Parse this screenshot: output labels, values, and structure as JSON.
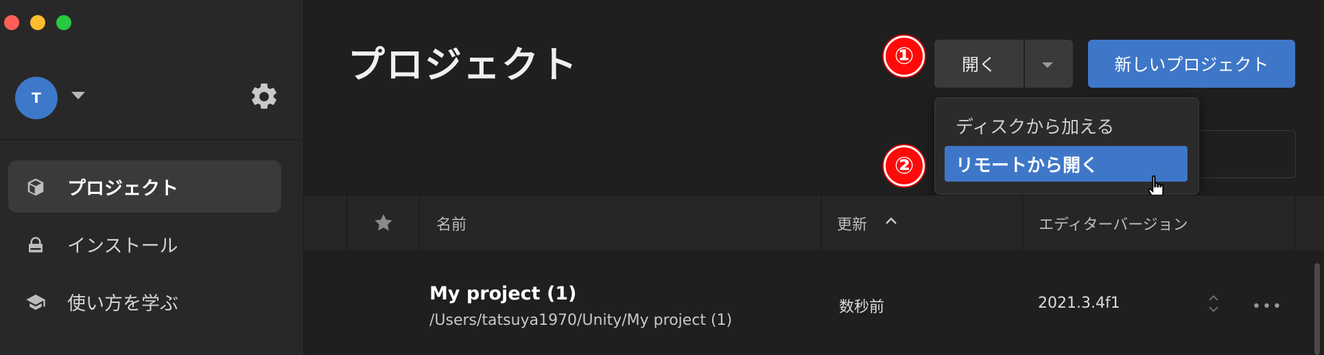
{
  "window": {
    "controls": [
      {
        "name": "close",
        "color": "#ff5f57"
      },
      {
        "name": "minimize",
        "color": "#febc2e"
      },
      {
        "name": "zoom",
        "color": "#28c840"
      }
    ]
  },
  "sidebar": {
    "avatar_initial": "T",
    "items": [
      {
        "label": "プロジェクト",
        "icon": "cube-icon",
        "active": true
      },
      {
        "label": "インストール",
        "icon": "lock-icon",
        "active": false
      },
      {
        "label": "使い方を学ぶ",
        "icon": "graduation-cap-icon",
        "active": false
      }
    ]
  },
  "main": {
    "title": "プロジェクト",
    "badges": {
      "step1": "①",
      "step2": "②"
    },
    "open_button": "開く",
    "new_project_button": "新しいプロジェクト",
    "dropdown": {
      "items": [
        {
          "label": "ディスクから加える",
          "highlighted": false
        },
        {
          "label": "リモートから開く",
          "highlighted": true
        }
      ]
    }
  },
  "table": {
    "columns": [
      "名前",
      "更新",
      "エディターバージョン"
    ],
    "sort_column": "更新",
    "sort_direction": "ascending",
    "rows": [
      {
        "name": "My project (1)",
        "path": "/Users/tatsuya1970/Unity/My project (1)",
        "modified": "数秒前",
        "version": "2021.3.4f1",
        "more": "•••"
      }
    ]
  },
  "colors": {
    "accent": "#3f77c8",
    "badge": "#ff0a0a",
    "background": "#1f1f1f",
    "sidebar": "#282828"
  }
}
